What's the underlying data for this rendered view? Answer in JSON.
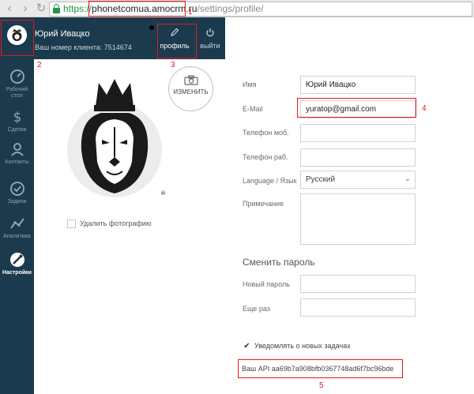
{
  "browser": {
    "url_scheme": "https://",
    "url_host": "phonetcomua.amocrm.ru",
    "url_path": "/settings/profile/"
  },
  "header": {
    "user_name": "Юрий Ивацко",
    "client_label": "Ваш номер клиента:",
    "client_number": "7514674",
    "profile_label": "профиль",
    "logout_label": "выйти"
  },
  "sidebar": {
    "items": [
      {
        "label": "Рабочий стол",
        "icon": "dashboard-icon"
      },
      {
        "label": "Сделки",
        "icon": "dollar-icon"
      },
      {
        "label": "Контакты",
        "icon": "contacts-icon"
      },
      {
        "label": "Задачи",
        "icon": "tasks-icon"
      },
      {
        "label": "Аналитика",
        "icon": "analytics-icon"
      },
      {
        "label": "Настройки",
        "icon": "settings-icon",
        "active": true
      }
    ]
  },
  "photo": {
    "change_label": "ИЗМЕНИТЬ",
    "delete_label": "Удалить фотографию"
  },
  "form": {
    "name_label": "Имя",
    "name_value": "Юрий Ивацко",
    "email_label": "E-Mail",
    "email_value": "yuratop@gmail.com",
    "mobile_label": "Телефон моб.",
    "work_label": "Телефон раб.",
    "language_label": "Language / Язык",
    "language_value": "Русский",
    "note_label": "Примечание",
    "change_password_title": "Сменить пароль",
    "new_password_label": "Новый пароль",
    "repeat_label": "Еще раз",
    "notify_label": "Уведомлять о новых задачах",
    "api_label": "Ваш API",
    "api_key": "aa69b7a908bfb0367748ad6f7bc96bde"
  },
  "annotations": [
    "1",
    "2",
    "3",
    "4",
    "5"
  ],
  "colors": {
    "sidebar": "#1b3a4d",
    "highlight": "#e21b1b",
    "secure": "#1a9c3e"
  }
}
